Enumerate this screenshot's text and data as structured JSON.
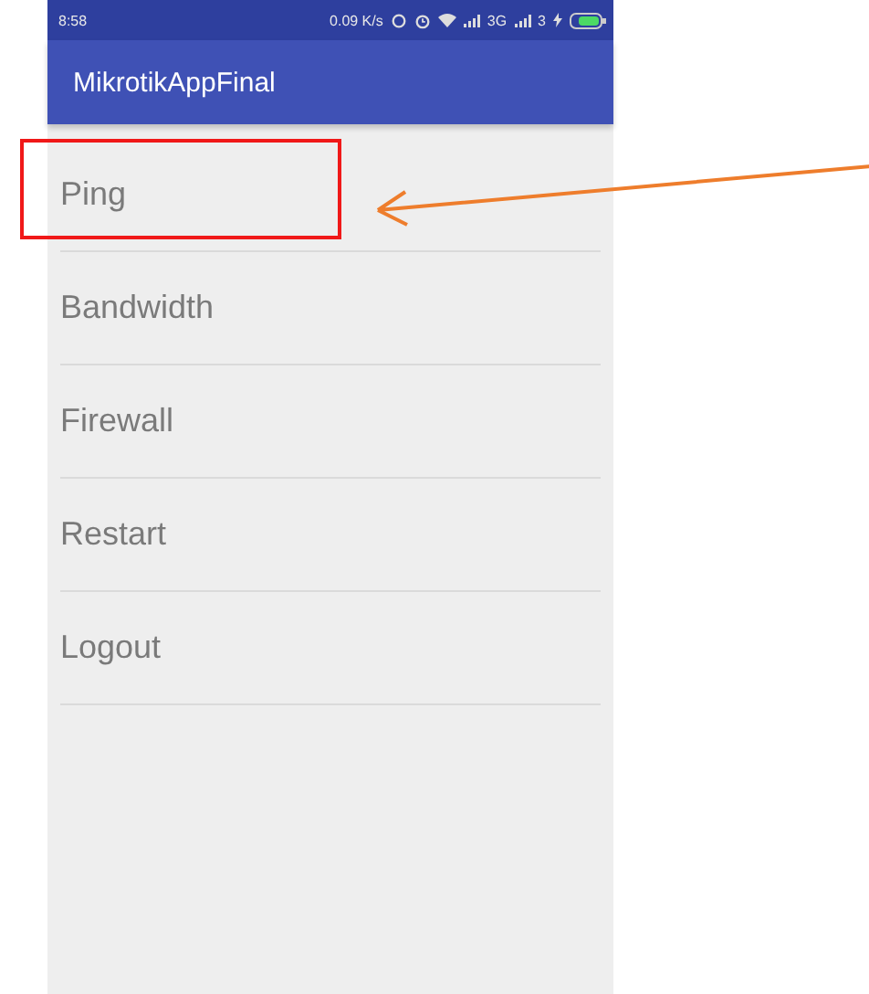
{
  "status_bar": {
    "time": "8:58",
    "speed": "0.09 K/s",
    "network_1": "3G",
    "network_2": "3"
  },
  "app_bar": {
    "title": "MikrotikAppFinal"
  },
  "menu_items": [
    {
      "label": "Ping",
      "highlighted": true
    },
    {
      "label": "Bandwidth",
      "highlighted": false
    },
    {
      "label": "Firewall",
      "highlighted": false
    },
    {
      "label": "Restart",
      "highlighted": false
    },
    {
      "label": "Logout",
      "highlighted": false
    }
  ]
}
